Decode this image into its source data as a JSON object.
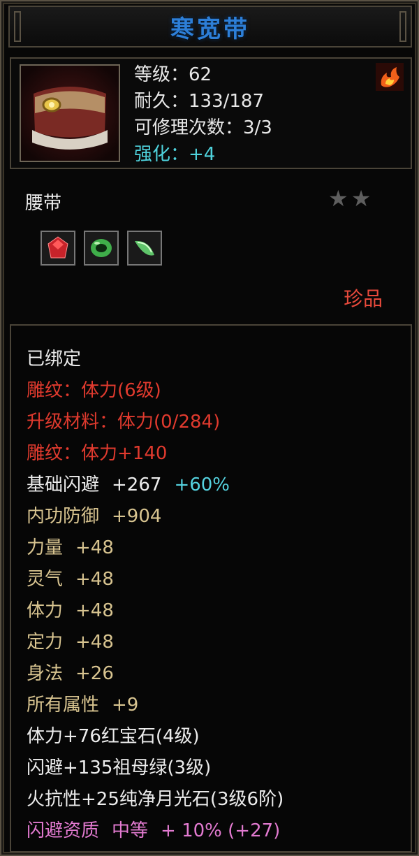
{
  "title": "寒宽带",
  "info": {
    "level": "等级：62",
    "durability": "耐久：133/187",
    "repairs": "可修理次数：3/3",
    "enhance": "强化：+4"
  },
  "item_type": "腰带",
  "stars": [
    "★",
    "★"
  ],
  "rarity": "珍品",
  "gems": [
    {
      "name": "ruby-gem-icon",
      "color": "#c8232a"
    },
    {
      "name": "emerald-gem-icon",
      "color": "#3fae4a"
    },
    {
      "name": "moonstone-gem-icon",
      "color": "#5fc46a"
    }
  ],
  "attributes": {
    "bound": "已绑定",
    "engrave": "雕纹：体力(6级)",
    "upgrade_mat": "升级材料：体力(0/284)",
    "engrave_bonus": "雕纹：体力+140",
    "dodge_name": "基础闪避",
    "dodge_val": "+267",
    "dodge_pct": "+60%",
    "inner_def_name": "内功防御",
    "inner_def_val": "+904",
    "str_name": "力量",
    "str_val": "+48",
    "spirit_name": "灵气",
    "spirit_val": "+48",
    "vit_name": "体力",
    "vit_val": "+48",
    "focus_name": "定力",
    "focus_val": "+48",
    "agi_name": "身法",
    "agi_val": "+26",
    "all_name": "所有属性",
    "all_val": "+9",
    "gem1": "体力+76红宝石(4级)",
    "gem2": "闪避+135祖母绿(3级)",
    "gem3": "火抗性+25纯净月光石(3级6阶)",
    "quality_name": "闪避资质",
    "quality_grade": "中等",
    "quality_bonus": "+ 10% (+27)"
  },
  "colors": {
    "title": "#2d7fd8",
    "enhance": "#4fd3dd",
    "red_text": "#e03a2e",
    "gold_text": "#d8c490",
    "pink_text": "#e27ad0",
    "rarity": "#e84a3c"
  }
}
